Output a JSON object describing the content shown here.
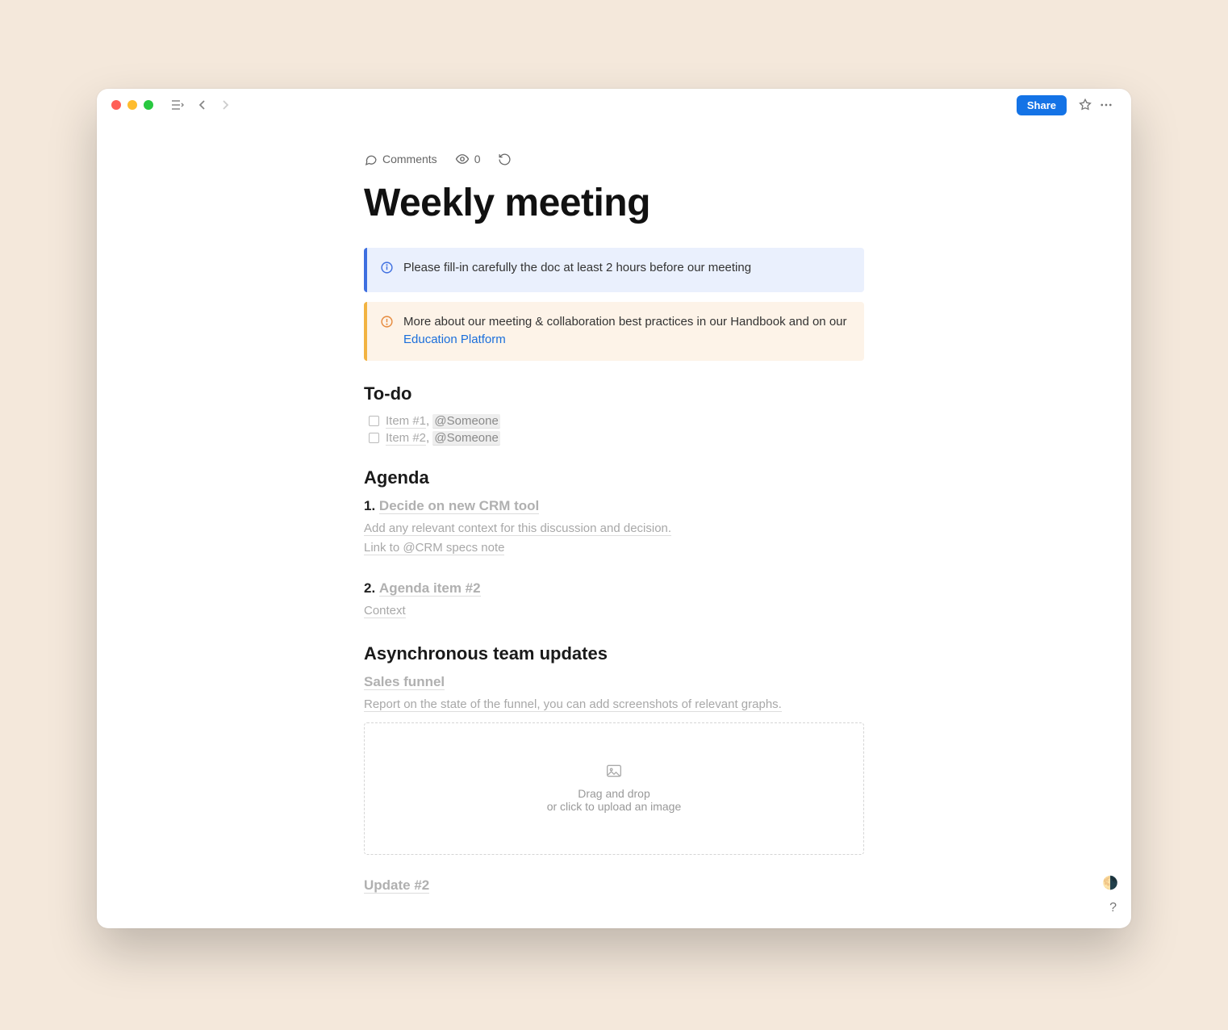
{
  "header": {
    "share_label": "Share",
    "comments_label": "Comments",
    "views_count": "0"
  },
  "document": {
    "title": "Weekly meeting",
    "callout_info": "Please fill-in carefully the doc at least 2 hours before our meeting",
    "callout_warn_text": "More about our meeting & collaboration best practices in our Handbook and on our ",
    "callout_warn_link": "Education Platform",
    "todo_heading": "To-do",
    "todos": [
      {
        "text": "Item #1",
        "mention": "@Someone"
      },
      {
        "text": "Item #2",
        "mention": "@Someone"
      }
    ],
    "agenda_heading": "Agenda",
    "agenda": [
      {
        "num": "1.",
        "title": "Decide on new CRM tool",
        "body_line1": "Add any relevant context for this discussion and decision.",
        "body_line2": "Link to @CRM specs note"
      },
      {
        "num": "2.",
        "title": "Agenda item #2",
        "body_line1": "Context",
        "body_line2": ""
      }
    ],
    "updates_heading": "Asynchronous team updates",
    "updates": {
      "section1_title": "Sales funnel",
      "section1_body": "Report on the state of the funnel, you can add screenshots of relevant graphs.",
      "section2_title": "Update #2"
    },
    "dropzone_line1": "Drag and drop",
    "dropzone_line2": "or click to upload an image"
  }
}
